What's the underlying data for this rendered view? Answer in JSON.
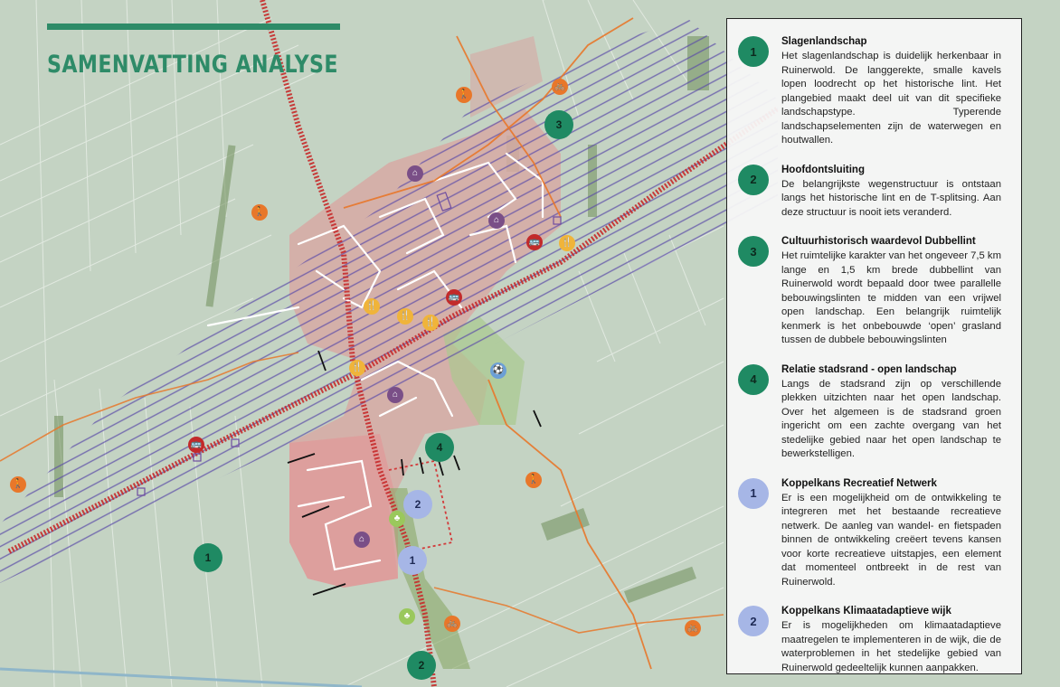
{
  "title": "SAMENVATTING ANALYSE",
  "legend": [
    {
      "number": "1",
      "color": "green",
      "heading": "Slagenlandschap",
      "text": "Het slagenlandschap is duidelijk herkenbaar in Ruinerwold. De langgerekte, smalle kavels lopen loodrecht op het historische lint. Het plangebied maakt deel uit van dit specifieke landschapstype. Typerende landschapselementen zijn de waterwegen en houtwallen."
    },
    {
      "number": "2",
      "color": "green",
      "heading": "Hoofdontsluiting",
      "text": "De belangrijkste wegenstructuur is ontstaan langs het historische lint en de T-splitsing. Aan deze structuur is nooit iets veranderd."
    },
    {
      "number": "3",
      "color": "green",
      "heading": "Cultuurhistorisch waardevol Dubbellint",
      "text": "Het ruimtelijke karakter van het ongeveer 7,5 km lange en 1,5 km brede dubbellint van Ruinerwold wordt bepaald door twee parallelle bebouwingslinten te midden van een vrijwel open landschap. Een belangrijk ruimtelijk kenmerk is het onbebouwde ‘open’ grasland tussen de dubbele bebouwingslinten"
    },
    {
      "number": "4",
      "color": "green",
      "heading": "Relatie stadsrand - open landschap",
      "text": "Langs de stadsrand zijn op verschillende plekken uitzichten naar het open landschap. Over het algemeen is de stadsrand groen ingericht om een zachte overgang van het stedelijke gebied naar het open landschap te bewerkstelligen."
    },
    {
      "number": "1",
      "color": "blue",
      "heading": "Koppelkans Recreatief Netwerk",
      "text": "Er is een mogelijkheid om de ontwikkeling te integreren met het bestaande recreatieve netwerk. De aanleg van wandel- en fietspaden binnen de ontwikkeling creëert tevens kansen voor korte recreatieve uitstapjes, een element dat momenteel ontbreekt in de rest van Ruinerwold."
    },
    {
      "number": "2",
      "color": "blue",
      "heading": "Koppelkans Klimaatadaptieve wijk",
      "text": "Er is mogelijkheden om klimaatadaptieve maatregelen te implementeren in de wijk, die de waterproblemen in het stedelijke gebied van Ruinerwold gedeeltelijk kunnen aanpakken."
    }
  ],
  "map_labels": [
    {
      "number": "3",
      "color": "green"
    },
    {
      "number": "4",
      "color": "green"
    },
    {
      "number": "1",
      "color": "green"
    },
    {
      "number": "2",
      "color": "green"
    },
    {
      "number": "2",
      "color": "blue"
    },
    {
      "number": "1",
      "color": "blue"
    }
  ],
  "colors": {
    "green": "#1f8a63",
    "blue": "#a6b6e6",
    "route_orange": "#e8772a",
    "road_red": "#c62a2a",
    "lint_purple": "#5b4aa8",
    "urban": "#d7a9a4"
  },
  "pois": [
    {
      "type": "walk",
      "icon": "walking-icon",
      "glyph": "🚶"
    },
    {
      "type": "bike",
      "icon": "bicycle-icon",
      "glyph": "🚲"
    },
    {
      "type": "food",
      "icon": "restaurant-icon",
      "glyph": "🍴"
    },
    {
      "type": "bus",
      "icon": "bus-icon",
      "glyph": "🚌"
    },
    {
      "type": "house",
      "icon": "house-icon",
      "glyph": "⌂"
    },
    {
      "type": "tree",
      "icon": "tree-icon",
      "glyph": "♣"
    },
    {
      "type": "sport",
      "icon": "sport-icon",
      "glyph": "⚽"
    }
  ]
}
